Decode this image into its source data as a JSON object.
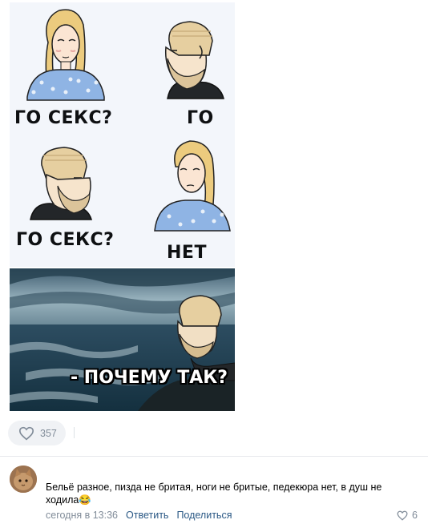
{
  "meme": {
    "caption_1": "ГО СЕКС?",
    "caption_2": "ГО",
    "caption_3": "ГО СЕКС?",
    "caption_4": "НЕТ",
    "caption_5": "- ПОЧЕМУ ТАК?"
  },
  "post": {
    "likes": "357"
  },
  "comment": {
    "text": "Бельё разное, пизда не бритая, ноги не бритые, педекюра нет, в душ не ходила😂",
    "time": "сегодня в 13:36",
    "reply_label": "Ответить",
    "share_label": "Поделиться",
    "likes": "6"
  },
  "colors": {
    "link": "#2a5885",
    "muted": "#818c99",
    "button_bg": "#f0f2f5"
  }
}
